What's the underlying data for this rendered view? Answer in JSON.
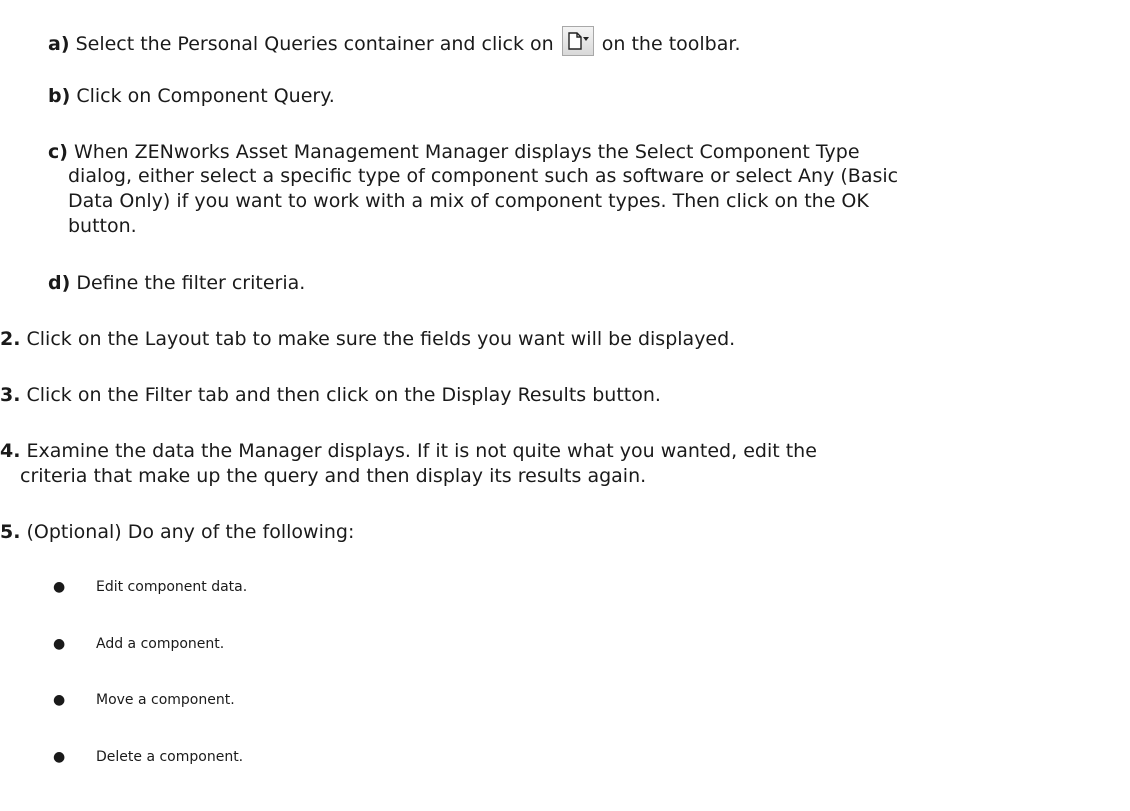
{
  "substeps": [
    {
      "marker": "a)",
      "before_icon": "Select the Personal Queries container and click on",
      "icon": "new-query-dropdown-icon",
      "after_icon": "on the toolbar."
    },
    {
      "marker": "b)",
      "text": "Click on Component Query."
    },
    {
      "marker": "c)",
      "lines": [
        "When ZENworks Asset Management Manager displays the Select Component Type",
        "dialog, either select a specific type of component such as software or select Any (Basic",
        "Data Only) if you want to work with a mix of component types. Then click on the OK",
        "button."
      ]
    },
    {
      "marker": "d)",
      "text": "Define the filter criteria."
    }
  ],
  "steps": [
    {
      "marker": "2.",
      "lines": [
        "Click on the Layout tab to make sure the fields you want will be displayed."
      ]
    },
    {
      "marker": "3.",
      "lines": [
        "Click on the Filter tab and then click on the Display Results button."
      ]
    },
    {
      "marker": "4.",
      "lines": [
        "Examine the data the Manager displays. If it is not quite what you wanted, edit the",
        "criteria that make up the query and then display its results again."
      ]
    },
    {
      "marker": "5.",
      "lines": [
        "(Optional) Do any of the following:"
      ]
    }
  ],
  "bullets": [
    "Edit component data.",
    "Add a component.",
    "Move a component.",
    "Delete a component."
  ]
}
